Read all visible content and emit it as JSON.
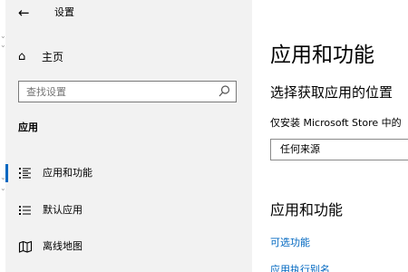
{
  "window": {
    "title": "设置",
    "accent_color": "#0067c0",
    "sidebar_bg": "#f2f2f2"
  },
  "header": {
    "back_icon": "←"
  },
  "sidebar": {
    "home": {
      "icon": "⌂",
      "label": "主页"
    },
    "search": {
      "placeholder": "查找设置"
    },
    "section_title": "应用",
    "items": [
      {
        "icon": "list-icon",
        "label": "应用和功能",
        "selected": true
      },
      {
        "icon": "default-apps-icon",
        "label": "默认应用",
        "selected": false
      },
      {
        "icon": "offline-maps-icon",
        "label": "离线地图",
        "selected": false
      }
    ]
  },
  "main": {
    "title": "应用和功能",
    "install_source_heading": "选择获取应用的位置",
    "install_source_text": "仅安装 Microsoft Store 中的",
    "install_source_value": "任何来源",
    "apps_heading": "应用和功能",
    "links": [
      "可选功能",
      "应用执行别名"
    ]
  }
}
